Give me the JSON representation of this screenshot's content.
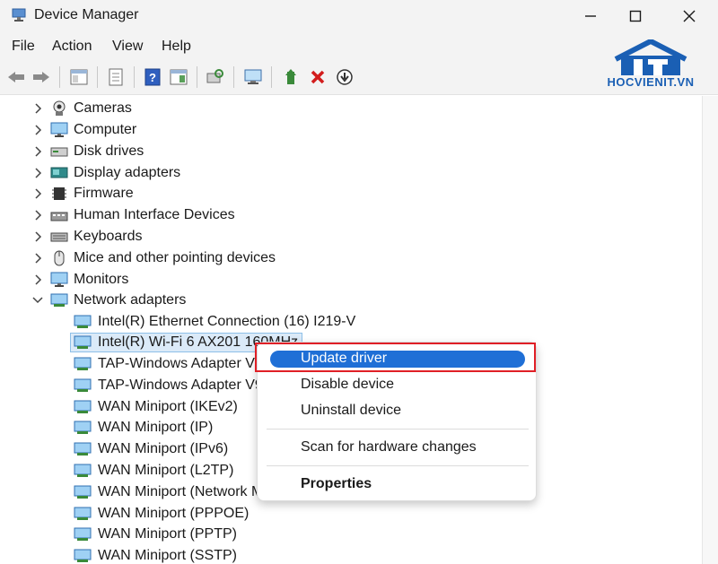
{
  "window": {
    "title": "Device Manager"
  },
  "menubar": [
    "File",
    "Action",
    "View",
    "Help"
  ],
  "watermark": {
    "brand": "HOCVIENIT.VN"
  },
  "tree": {
    "categories": [
      {
        "label": "Cameras",
        "icon": "camera-icon",
        "expanded": false
      },
      {
        "label": "Computer",
        "icon": "monitor-icon",
        "expanded": false
      },
      {
        "label": "Disk drives",
        "icon": "disk-drive-icon",
        "expanded": false
      },
      {
        "label": "Display adapters",
        "icon": "display-adapter-icon",
        "expanded": false
      },
      {
        "label": "Firmware",
        "icon": "firmware-icon",
        "expanded": false
      },
      {
        "label": "Human Interface Devices",
        "icon": "hid-icon",
        "expanded": false
      },
      {
        "label": "Keyboards",
        "icon": "keyboard-icon",
        "expanded": false
      },
      {
        "label": "Mice and other pointing devices",
        "icon": "mouse-icon",
        "expanded": false
      },
      {
        "label": "Monitors",
        "icon": "monitor-icon",
        "expanded": false
      },
      {
        "label": "Network adapters",
        "icon": "network-icon",
        "expanded": true
      }
    ],
    "network_children": [
      "Intel(R) Ethernet Connection (16) I219-V",
      "Intel(R) Wi-Fi 6 AX201 160MHz",
      "TAP-Windows Adapter V9",
      "TAP-Windows Adapter V9",
      "WAN Miniport (IKEv2)",
      "WAN Miniport (IP)",
      "WAN Miniport (IPv6)",
      "WAN Miniport (L2TP)",
      "WAN Miniport (Network Monitor)",
      "WAN Miniport (PPPOE)",
      "WAN Miniport (PPTP)",
      "WAN Miniport (SSTP)"
    ]
  },
  "context_menu": {
    "update_driver": "Update driver",
    "disable_device": "Disable device",
    "uninstall_device": "Uninstall device",
    "scan": "Scan for hardware changes",
    "properties": "Properties"
  },
  "colors": {
    "accent": "#1f6fd6",
    "highlight_box": "#e01f26",
    "selection": "#dbeaf8"
  }
}
